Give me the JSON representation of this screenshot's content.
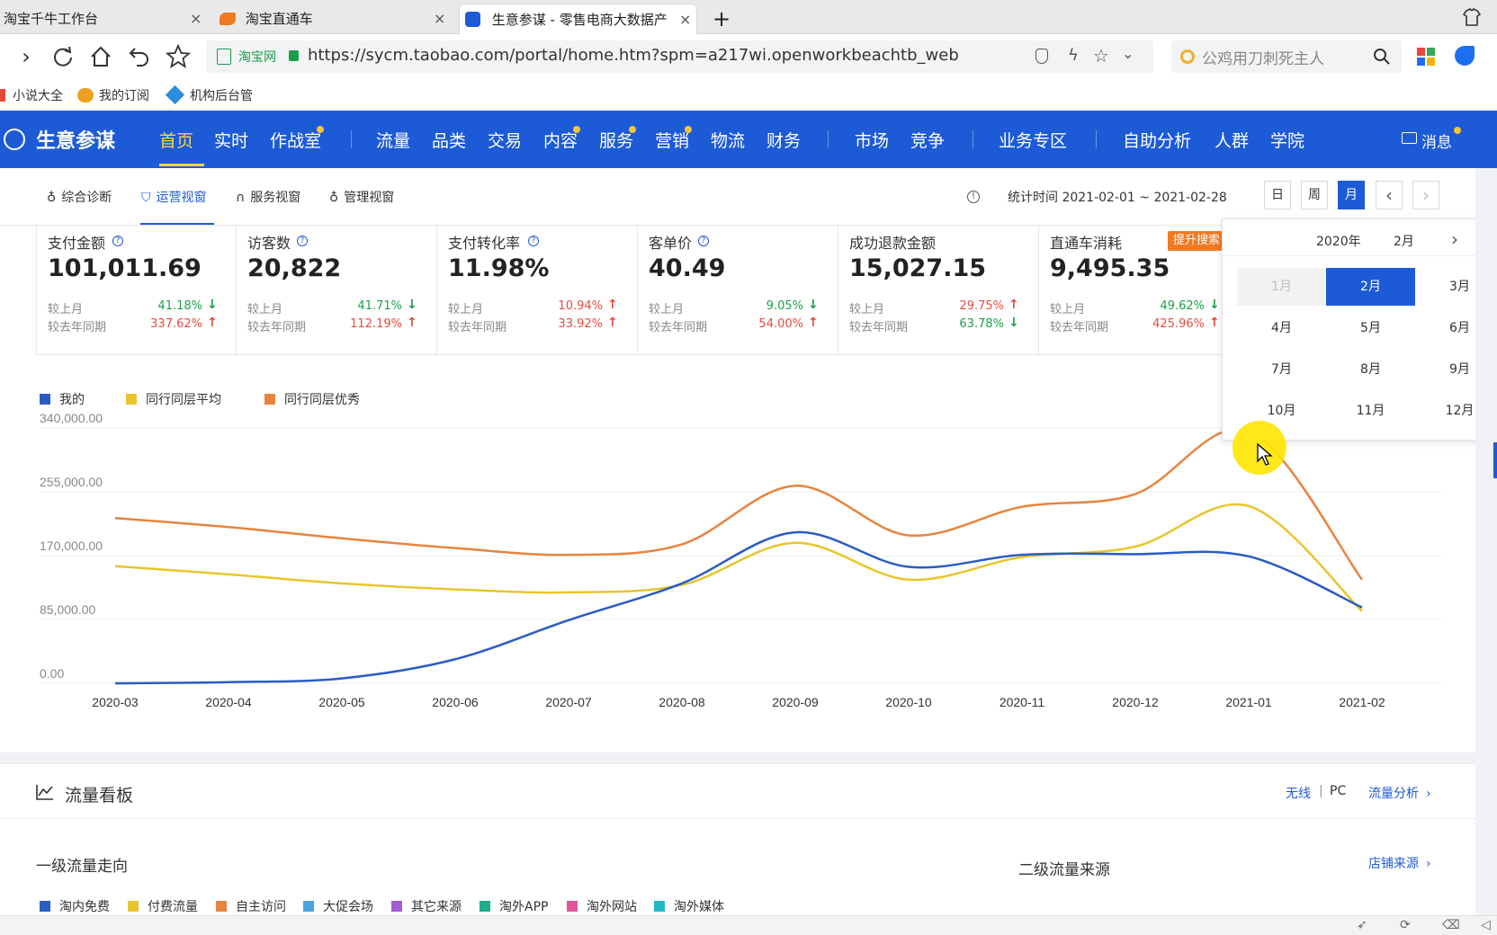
{
  "browser": {
    "tabs": [
      {
        "label": "淘宝千牛工作台",
        "close": "×"
      },
      {
        "label": "淘宝直通车",
        "close": "×"
      },
      {
        "label": "生意参谋 - 零售电商大数据产",
        "close": "×"
      }
    ],
    "new_tab": "+",
    "url_site_label": "淘宝网",
    "url": "https://sycm.taobao.com/portal/home.htm?spm=a217wi.openworkbeachtb_web",
    "search_placeholder": "公鸡用刀刺死主人",
    "bookmarks": [
      "小说大全",
      "我的订阅",
      "机构后台管"
    ]
  },
  "app": {
    "brand": "生意参谋",
    "nav": [
      "首页",
      "实时",
      "作战室",
      "流量",
      "品类",
      "交易",
      "内容",
      "服务",
      "营销",
      "物流",
      "财务",
      "市场",
      "竞争",
      "业务专区",
      "自助分析",
      "人群",
      "学院"
    ],
    "message": "消息"
  },
  "subnav": {
    "items": [
      "综合诊断",
      "运营视窗",
      "服务视窗",
      "管理视窗"
    ],
    "stat_time": "统计时间 2021-02-01 ~ 2021-02-28",
    "buttons": [
      "日",
      "周",
      "月"
    ],
    "prev": "‹",
    "next": "›"
  },
  "kpis": [
    {
      "title": "支付金额",
      "help": true,
      "value": "101,011.69",
      "row1_label": "较上月",
      "row1_pct": "41.18%",
      "row1_dir": "down",
      "row2_label": "较去年同期",
      "row2_pct": "337.62%",
      "row2_dir": "up"
    },
    {
      "title": "访客数",
      "help": true,
      "value": "20,822",
      "row1_label": "较上月",
      "row1_pct": "41.71%",
      "row1_dir": "down",
      "row2_label": "较去年同期",
      "row2_pct": "112.19%",
      "row2_dir": "up"
    },
    {
      "title": "支付转化率",
      "help": true,
      "value": "11.98%",
      "row1_label": "较上月",
      "row1_pct": "10.94%",
      "row1_dir": "up",
      "row2_label": "较去年同期",
      "row2_pct": "33.92%",
      "row2_dir": "up"
    },
    {
      "title": "客单价",
      "help": true,
      "value": "40.49",
      "row1_label": "较上月",
      "row1_pct": "9.05%",
      "row1_dir": "down",
      "row2_label": "较去年同期",
      "row2_pct": "54.00%",
      "row2_dir": "up"
    },
    {
      "title": "成功退款金额",
      "help": false,
      "value": "15,027.15",
      "row1_label": "较上月",
      "row1_pct": "29.75%",
      "row1_dir": "up",
      "row2_label": "较去年同期",
      "row2_pct": "63.78%",
      "row2_dir": "down"
    },
    {
      "title": "直通车消耗",
      "help": false,
      "value": "9,495.35",
      "row1_label": "较上月",
      "row1_pct": "49.62%",
      "row1_dir": "down",
      "row2_label": "较去年同期",
      "row2_pct": "425.96%",
      "row2_dir": "up",
      "badge": "提升搜索"
    }
  ],
  "chart_data": {
    "type": "line",
    "x": [
      "2020-03",
      "2020-04",
      "2020-05",
      "2020-06",
      "2020-07",
      "2020-08",
      "2020-09",
      "2020-10",
      "2020-11",
      "2020-12",
      "2021-01",
      "2021-02"
    ],
    "y_ticks": [
      "340,000.00",
      "255,000.00",
      "170,000.00",
      "85,000.00",
      "0.00"
    ],
    "ylim": [
      0,
      340000
    ],
    "series": [
      {
        "name": "我的",
        "color": "#2a5cc4",
        "values": [
          0,
          1500,
          6500,
          32000,
          84000,
          133000,
          201000,
          155000,
          171000,
          172000,
          169000,
          101012
        ]
      },
      {
        "name": "同行同层平均",
        "color": "#e9c52c",
        "values": [
          156000,
          145000,
          133000,
          125000,
          121000,
          131000,
          187000,
          138000,
          168000,
          182000,
          236000,
          96000
        ]
      },
      {
        "name": "同行同层优秀",
        "color": "#e8843f",
        "values": [
          220000,
          208000,
          193000,
          180000,
          171000,
          185000,
          263000,
          197000,
          235000,
          252000,
          336000,
          138000
        ]
      }
    ],
    "legend": "top-left",
    "grid": true
  },
  "month_picker": {
    "year": "2020年",
    "month": "2月",
    "next": "›",
    "next_year": "»",
    "months": [
      "1月",
      "2月",
      "3月",
      "4月",
      "5月",
      "6月",
      "7月",
      "8月",
      "9月",
      "10月",
      "11月",
      "12月"
    ],
    "disabled": [
      "1月"
    ],
    "selected": "2月"
  },
  "flow": {
    "title": "流量看板",
    "device_wireless": "无线",
    "device_sep": "|",
    "device_pc": "PC",
    "analysis_link": "流量分析",
    "level1_title": "一级流量走向",
    "level2_title": "二级流量来源",
    "source_link": "店铺来源",
    "legend": [
      {
        "label": "淘内免费",
        "color": "#2a5cc4"
      },
      {
        "label": "付费流量",
        "color": "#e9c52c"
      },
      {
        "label": "自主访问",
        "color": "#e8843f"
      },
      {
        "label": "大促会场",
        "color": "#4aa3e2"
      },
      {
        "label": "其它来源",
        "color": "#a35bd6"
      },
      {
        "label": "淘外APP",
        "color": "#1aae8a"
      },
      {
        "label": "淘外网站",
        "color": "#e2559a"
      },
      {
        "label": "淘外媒体",
        "color": "#22b8c8"
      }
    ]
  }
}
